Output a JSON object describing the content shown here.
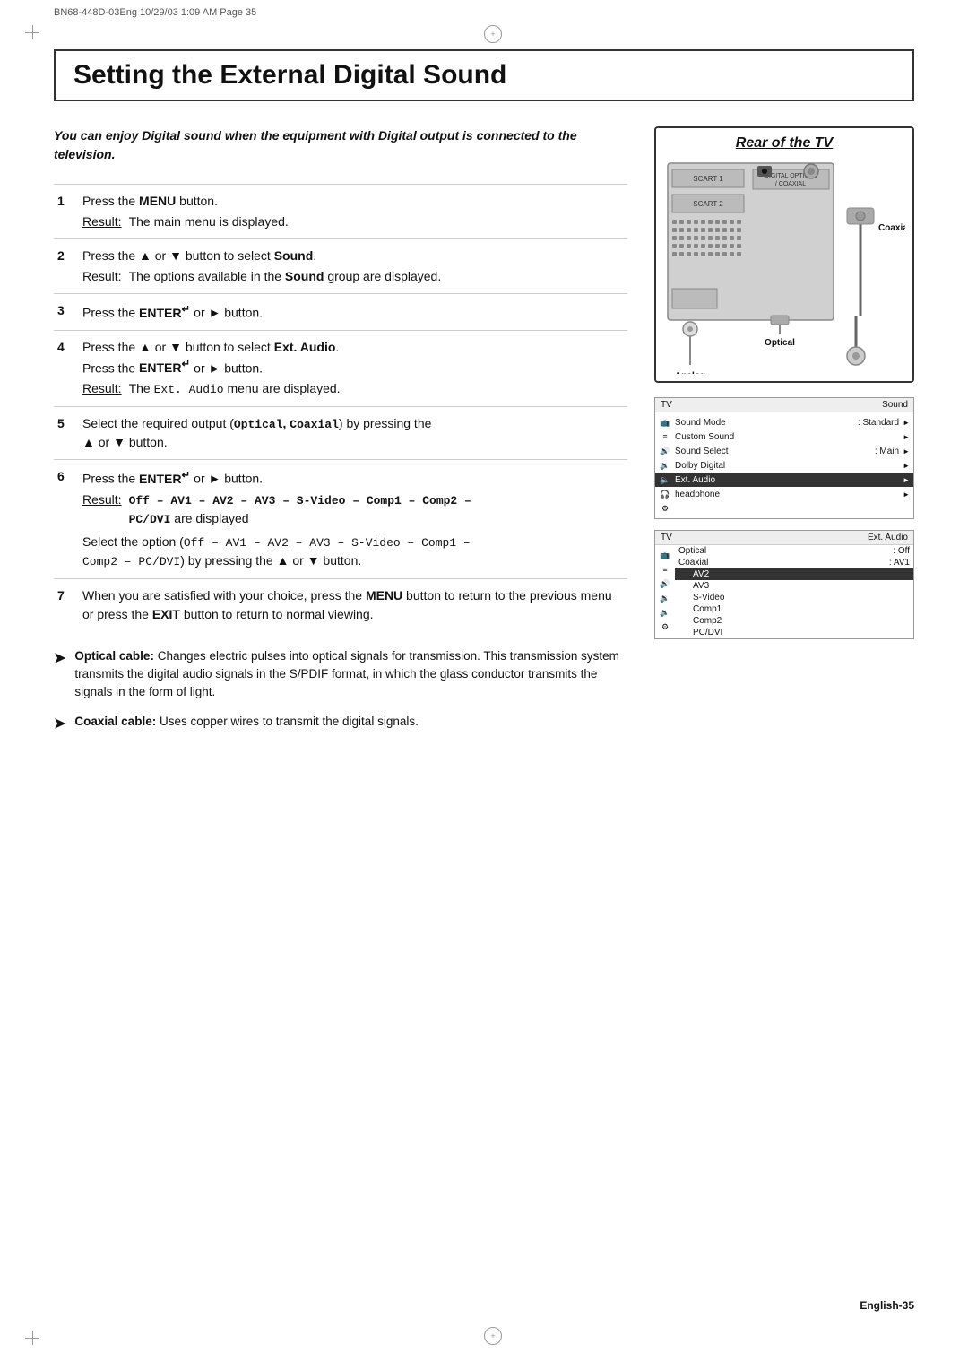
{
  "header": {
    "text": "BN68-448D-03Eng   10/29/03  1:09 AM   Page  35"
  },
  "title": "Setting the External Digital Sound",
  "intro": "You can enjoy Digital sound when the equipment with Digital output is connected to the television.",
  "steps": [
    {
      "num": "1",
      "instruction": "Press the ",
      "instruction_bold": "MENU",
      "instruction_end": " button.",
      "result_label": "Result:",
      "result_text": "The main menu is displayed."
    },
    {
      "num": "2",
      "instruction": "Press the ▲ or ▼ button to select ",
      "instruction_bold": "Sound",
      "instruction_end": ".",
      "result_label": "Result:",
      "result_text": "The options available in the Sound group are displayed."
    },
    {
      "num": "3",
      "instruction": "Press the ",
      "instruction_bold": "ENTER",
      "instruction_enter": "↵",
      "instruction_end": " or ► button."
    },
    {
      "num": "4",
      "instruction": "Press the ▲ or ▼ button to select ",
      "instruction_bold": "Ext. Audio",
      "instruction_end": ".",
      "line2": "Press the ",
      "line2_bold": "ENTER",
      "line2_enter": "↵",
      "line2_end": " or ► button.",
      "result_label": "Result:",
      "result_text": "The Ext. Audio menu are displayed."
    },
    {
      "num": "5",
      "instruction": "Select the required output (",
      "instruction_bold": "Optical, Coaxial",
      "instruction_end": ") by pressing the",
      "line2": "▲ or ▼ button."
    },
    {
      "num": "6",
      "instruction": "Press the ",
      "instruction_bold": "ENTER",
      "instruction_enter": "↵",
      "instruction_end": " or ► button.",
      "result_label": "Result:",
      "result_bold": "Off – AV1 – AV2 – AV3 – S-Video – Comp1 – Comp2 – PC/DVI",
      "result_text": " are displayed",
      "line2": "Select the option (",
      "line2_code": "Off – AV1 – AV2 – AV3 – S-Video – Comp1 –",
      "line2b": "Comp2 – PC/DVI",
      "line2_end": ") by pressing the ▲ or ▼ button."
    },
    {
      "num": "7",
      "instruction": "When you are satisfied with your choice, press the ",
      "instruction_bold": "MENU",
      "instruction_mid": " button to return to the previous menu or press the ",
      "instruction_bold2": "EXIT",
      "instruction_end": " button to return to normal viewing."
    }
  ],
  "notes": [
    {
      "title": "Optical cable:",
      "text": "Changes electric pulses into optical signals for transmission. This transmission system transmits the digital audio signals in the S/PDIF format, in which the glass conductor transmits the signals in the form of light."
    },
    {
      "title": "Coaxial cable:",
      "text": "Uses copper wires to transmit the digital signals."
    }
  ],
  "right_panel": {
    "rear_tv_label": "Rear of the TV",
    "analog_label": "Analog",
    "optical_label": "Optical",
    "coaxial_label": "Coaxial",
    "menu1": {
      "header_left": "TV",
      "header_right": "Sound",
      "rows": [
        {
          "icon": "📺",
          "text": "Sound Mode",
          "value": ": Standard",
          "arrow": "►",
          "active": false
        },
        {
          "icon": "≡",
          "text": "Custom Sound",
          "value": "",
          "arrow": "►",
          "active": false
        },
        {
          "icon": "🔊",
          "text": "Sound Select",
          "value": ": Main",
          "arrow": "►",
          "active": false
        },
        {
          "icon": "🔉",
          "text": "Dolby Digital",
          "value": "",
          "arrow": "►",
          "active": false
        },
        {
          "icon": "🔈",
          "text": "Ext. Audio",
          "value": "",
          "arrow": "►",
          "active": true
        },
        {
          "icon": "🎧",
          "text": "headphone",
          "value": "",
          "arrow": "►",
          "active": false
        },
        {
          "icon": "⚙",
          "text": "",
          "value": "",
          "arrow": "",
          "active": false
        }
      ]
    },
    "menu2": {
      "header_left": "TV",
      "header_right": "Ext. Audio",
      "rows": [
        {
          "icon": "📺",
          "text": "Optical",
          "value": ": Off",
          "arrow": "",
          "active": false
        },
        {
          "icon": "≡",
          "text": "Coaxial",
          "value": ": AV1",
          "arrow": "",
          "active": true
        },
        {
          "icon": "",
          "text": "",
          "value": "AV2",
          "arrow": "",
          "active": false
        },
        {
          "icon": "",
          "text": "",
          "value": "AV3",
          "arrow": "",
          "active": false
        },
        {
          "icon": "",
          "text": "",
          "value": "S-Video",
          "arrow": "",
          "active": false
        },
        {
          "icon": "",
          "text": "",
          "value": "Comp1",
          "arrow": "",
          "active": false
        },
        {
          "icon": "",
          "text": "",
          "value": "Comp2",
          "arrow": "",
          "active": false
        },
        {
          "icon": "",
          "text": "",
          "value": "PC/DVI",
          "arrow": "",
          "active": false
        }
      ]
    }
  },
  "page_number": "English-35"
}
